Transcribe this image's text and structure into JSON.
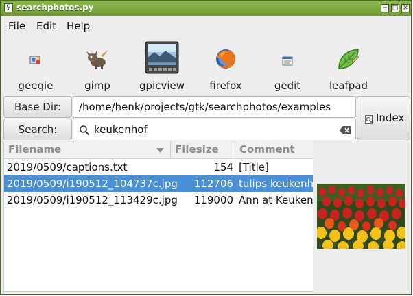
{
  "window": {
    "title": "searchphotos.py"
  },
  "menu": [
    "File",
    "Edit",
    "Help"
  ],
  "apps": [
    {
      "label": "geeqie",
      "icon": "geeqie-icon"
    },
    {
      "label": "gimp",
      "icon": "gimp-icon"
    },
    {
      "label": "gpicview",
      "icon": "gpicview-icon"
    },
    {
      "label": "firefox",
      "icon": "firefox-icon"
    },
    {
      "label": "gedit",
      "icon": "gedit-icon"
    },
    {
      "label": "leafpad",
      "icon": "leafpad-icon"
    }
  ],
  "basedir": {
    "label": "Base Dir:",
    "value": "/home/henk/projects/gtk/searchphotos/examples"
  },
  "search": {
    "label": "Search:",
    "value": "keukenhof"
  },
  "index_button": {
    "label": "Index"
  },
  "columns": [
    "Filename",
    "Filesize",
    "Comment"
  ],
  "rows": [
    {
      "filename": "2019/0509/captions.txt",
      "filesize": "154",
      "comment": "[Title]"
    },
    {
      "filename": "2019/0509/i190512_104737c.jpg",
      "filesize": "112706",
      "comment": "tulips keukenho"
    },
    {
      "filename": "2019/0509/i190512_113429c.jpg",
      "filesize": "119000",
      "comment": "Ann at Keukenh"
    }
  ],
  "selected_row": 1,
  "colors": {
    "titlebar": "#7ba63f",
    "selection": "#4a90d9"
  }
}
